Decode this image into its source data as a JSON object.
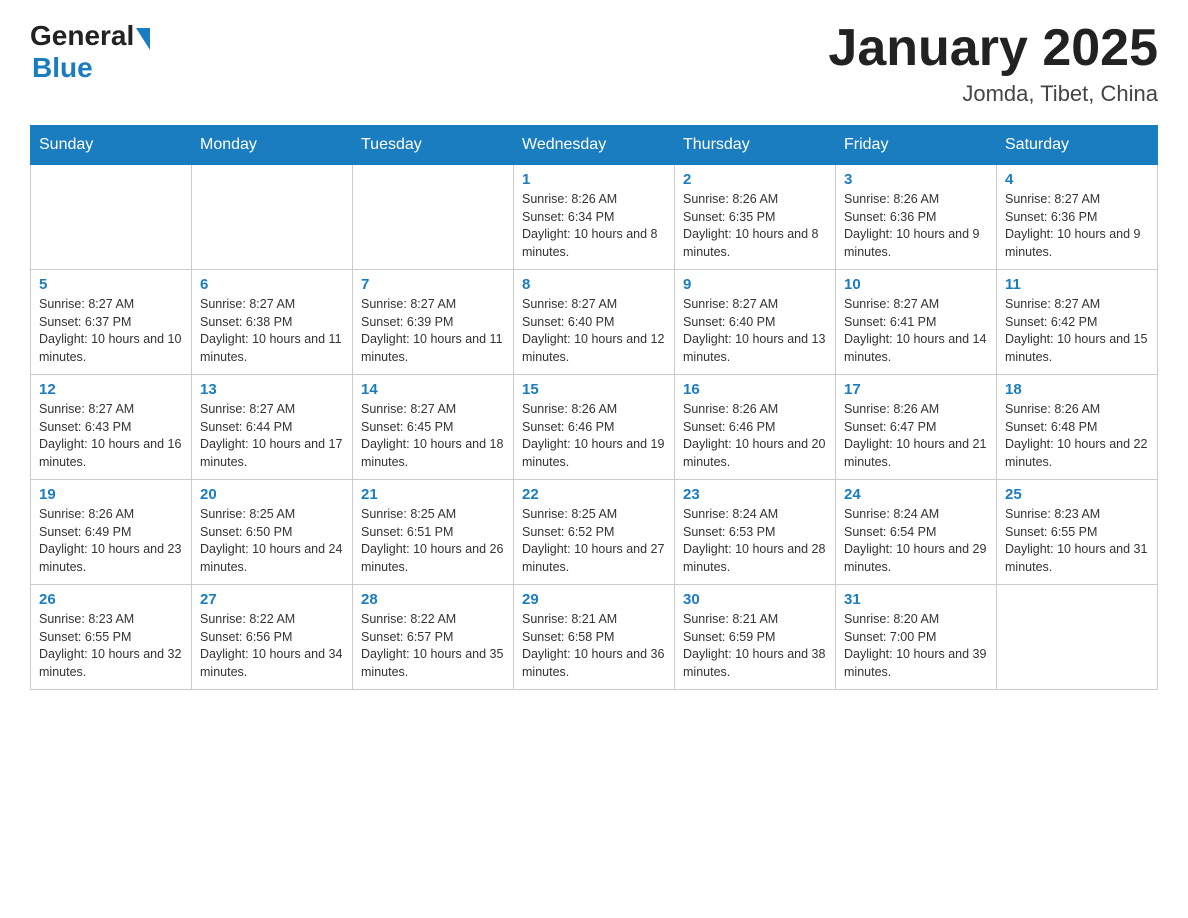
{
  "header": {
    "logo_general": "General",
    "logo_blue": "Blue",
    "title": "January 2025",
    "subtitle": "Jomda, Tibet, China"
  },
  "days_of_week": [
    "Sunday",
    "Monday",
    "Tuesday",
    "Wednesday",
    "Thursday",
    "Friday",
    "Saturday"
  ],
  "weeks": [
    [
      {
        "day": "",
        "info": ""
      },
      {
        "day": "",
        "info": ""
      },
      {
        "day": "",
        "info": ""
      },
      {
        "day": "1",
        "info": "Sunrise: 8:26 AM\nSunset: 6:34 PM\nDaylight: 10 hours and 8 minutes."
      },
      {
        "day": "2",
        "info": "Sunrise: 8:26 AM\nSunset: 6:35 PM\nDaylight: 10 hours and 8 minutes."
      },
      {
        "day": "3",
        "info": "Sunrise: 8:26 AM\nSunset: 6:36 PM\nDaylight: 10 hours and 9 minutes."
      },
      {
        "day": "4",
        "info": "Sunrise: 8:27 AM\nSunset: 6:36 PM\nDaylight: 10 hours and 9 minutes."
      }
    ],
    [
      {
        "day": "5",
        "info": "Sunrise: 8:27 AM\nSunset: 6:37 PM\nDaylight: 10 hours and 10 minutes."
      },
      {
        "day": "6",
        "info": "Sunrise: 8:27 AM\nSunset: 6:38 PM\nDaylight: 10 hours and 11 minutes."
      },
      {
        "day": "7",
        "info": "Sunrise: 8:27 AM\nSunset: 6:39 PM\nDaylight: 10 hours and 11 minutes."
      },
      {
        "day": "8",
        "info": "Sunrise: 8:27 AM\nSunset: 6:40 PM\nDaylight: 10 hours and 12 minutes."
      },
      {
        "day": "9",
        "info": "Sunrise: 8:27 AM\nSunset: 6:40 PM\nDaylight: 10 hours and 13 minutes."
      },
      {
        "day": "10",
        "info": "Sunrise: 8:27 AM\nSunset: 6:41 PM\nDaylight: 10 hours and 14 minutes."
      },
      {
        "day": "11",
        "info": "Sunrise: 8:27 AM\nSunset: 6:42 PM\nDaylight: 10 hours and 15 minutes."
      }
    ],
    [
      {
        "day": "12",
        "info": "Sunrise: 8:27 AM\nSunset: 6:43 PM\nDaylight: 10 hours and 16 minutes."
      },
      {
        "day": "13",
        "info": "Sunrise: 8:27 AM\nSunset: 6:44 PM\nDaylight: 10 hours and 17 minutes."
      },
      {
        "day": "14",
        "info": "Sunrise: 8:27 AM\nSunset: 6:45 PM\nDaylight: 10 hours and 18 minutes."
      },
      {
        "day": "15",
        "info": "Sunrise: 8:26 AM\nSunset: 6:46 PM\nDaylight: 10 hours and 19 minutes."
      },
      {
        "day": "16",
        "info": "Sunrise: 8:26 AM\nSunset: 6:46 PM\nDaylight: 10 hours and 20 minutes."
      },
      {
        "day": "17",
        "info": "Sunrise: 8:26 AM\nSunset: 6:47 PM\nDaylight: 10 hours and 21 minutes."
      },
      {
        "day": "18",
        "info": "Sunrise: 8:26 AM\nSunset: 6:48 PM\nDaylight: 10 hours and 22 minutes."
      }
    ],
    [
      {
        "day": "19",
        "info": "Sunrise: 8:26 AM\nSunset: 6:49 PM\nDaylight: 10 hours and 23 minutes."
      },
      {
        "day": "20",
        "info": "Sunrise: 8:25 AM\nSunset: 6:50 PM\nDaylight: 10 hours and 24 minutes."
      },
      {
        "day": "21",
        "info": "Sunrise: 8:25 AM\nSunset: 6:51 PM\nDaylight: 10 hours and 26 minutes."
      },
      {
        "day": "22",
        "info": "Sunrise: 8:25 AM\nSunset: 6:52 PM\nDaylight: 10 hours and 27 minutes."
      },
      {
        "day": "23",
        "info": "Sunrise: 8:24 AM\nSunset: 6:53 PM\nDaylight: 10 hours and 28 minutes."
      },
      {
        "day": "24",
        "info": "Sunrise: 8:24 AM\nSunset: 6:54 PM\nDaylight: 10 hours and 29 minutes."
      },
      {
        "day": "25",
        "info": "Sunrise: 8:23 AM\nSunset: 6:55 PM\nDaylight: 10 hours and 31 minutes."
      }
    ],
    [
      {
        "day": "26",
        "info": "Sunrise: 8:23 AM\nSunset: 6:55 PM\nDaylight: 10 hours and 32 minutes."
      },
      {
        "day": "27",
        "info": "Sunrise: 8:22 AM\nSunset: 6:56 PM\nDaylight: 10 hours and 34 minutes."
      },
      {
        "day": "28",
        "info": "Sunrise: 8:22 AM\nSunset: 6:57 PM\nDaylight: 10 hours and 35 minutes."
      },
      {
        "day": "29",
        "info": "Sunrise: 8:21 AM\nSunset: 6:58 PM\nDaylight: 10 hours and 36 minutes."
      },
      {
        "day": "30",
        "info": "Sunrise: 8:21 AM\nSunset: 6:59 PM\nDaylight: 10 hours and 38 minutes."
      },
      {
        "day": "31",
        "info": "Sunrise: 8:20 AM\nSunset: 7:00 PM\nDaylight: 10 hours and 39 minutes."
      },
      {
        "day": "",
        "info": ""
      }
    ]
  ]
}
